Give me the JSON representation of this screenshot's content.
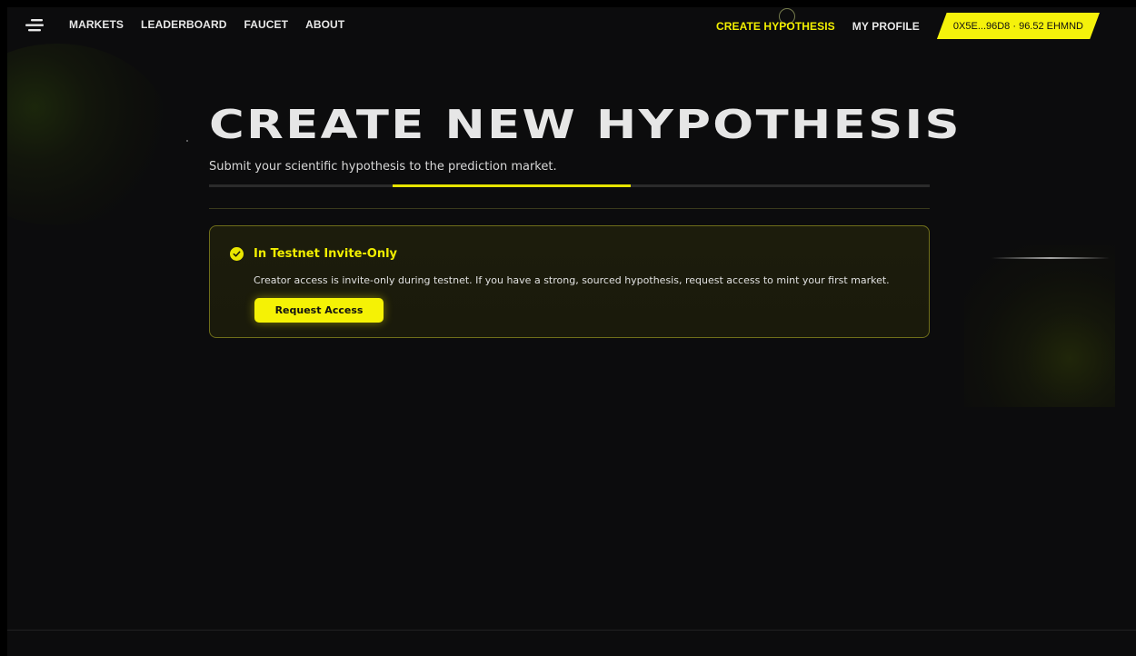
{
  "nav": {
    "links": [
      "MARKETS",
      "LEADERBOARD",
      "FAUCET",
      "ABOUT"
    ],
    "create_label": "CREATE HYPOTHESIS",
    "profile_label": "MY PROFILE",
    "wallet_label": "0X5E...96D8 · 96.52 EHMND"
  },
  "page": {
    "title": "CREATE NEW HYPOTHESIS",
    "subtitle": "Submit your scientific hypothesis to the prediction market.",
    "progress_fraction": 0.33
  },
  "notice": {
    "title": "In Testnet Invite-Only",
    "body": "Creator access is invite-only during testnet. If you have a strong, sourced hypothesis, request access to mint your first market.",
    "button_label": "Request Access"
  },
  "colors": {
    "accent": "#f5f20b",
    "background": "#0c0c0d"
  },
  "icons": {
    "menu": "menu-icon",
    "check": "check-circle-icon"
  }
}
